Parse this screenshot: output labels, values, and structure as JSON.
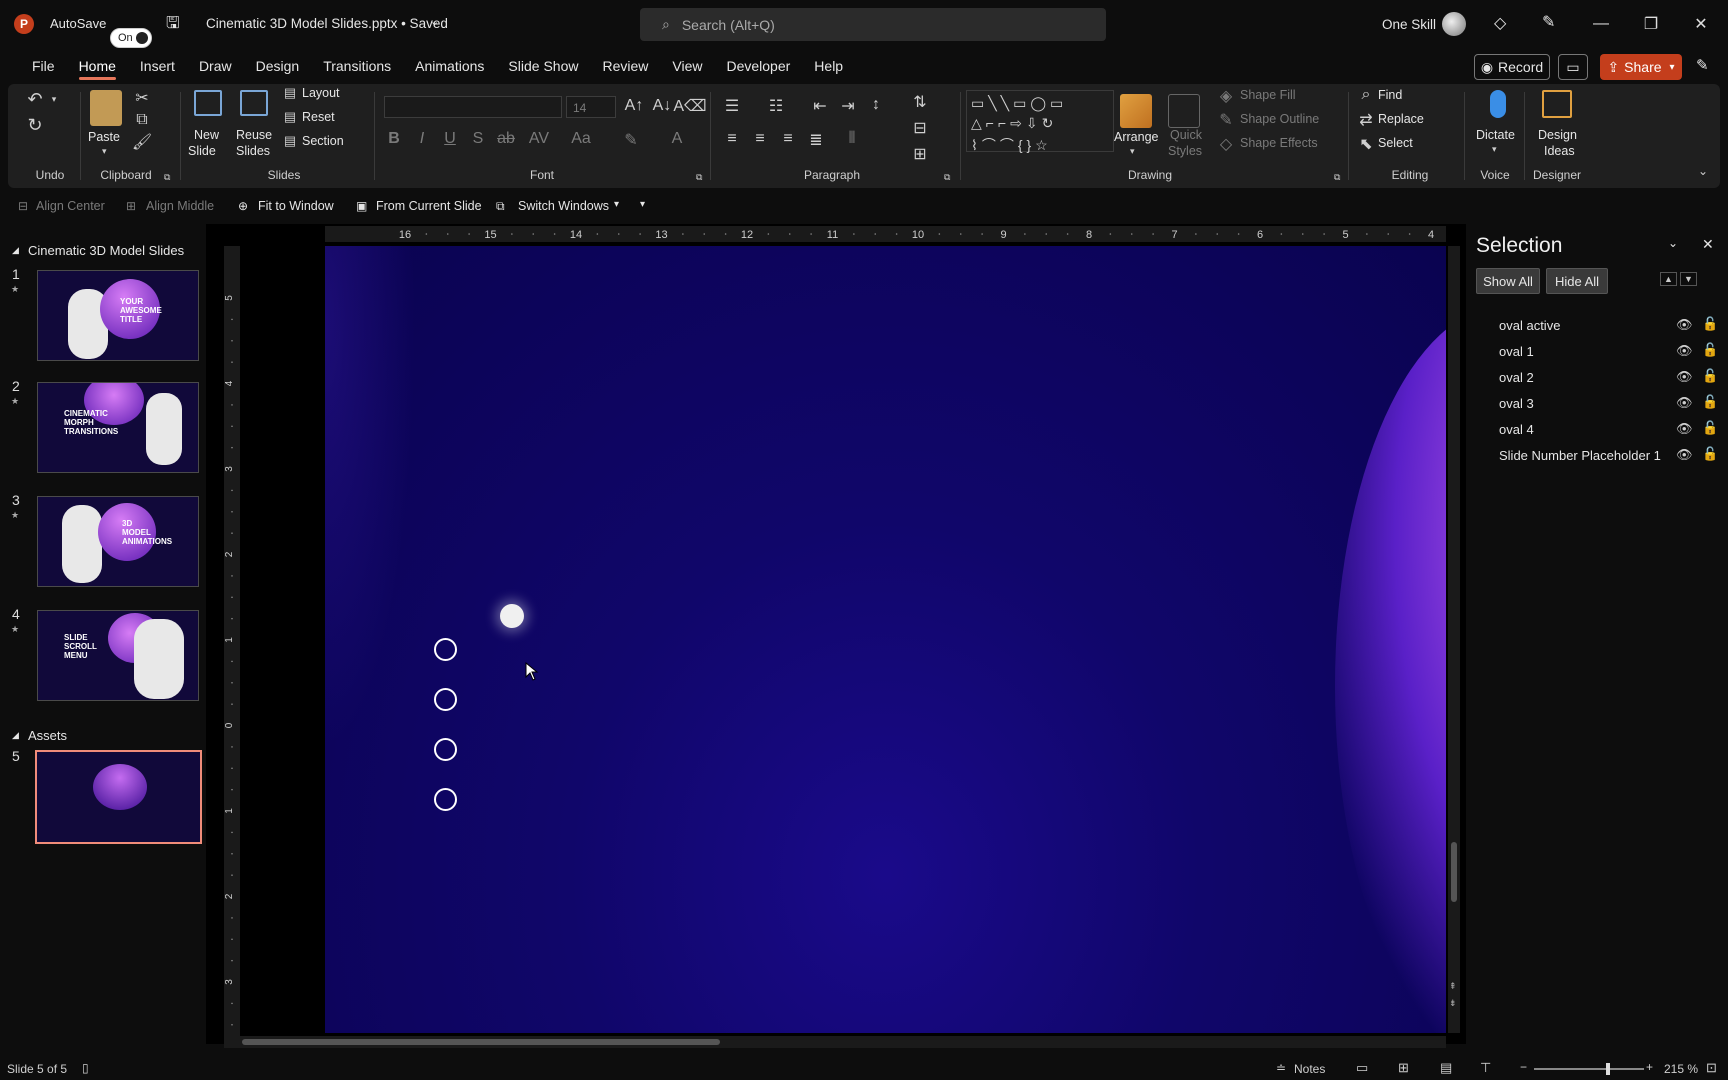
{
  "titlebar": {
    "app_logo": "P",
    "autosave_label": "AutoSave",
    "autosave_toggle": "On",
    "doc_title": "Cinematic 3D Model Slides.pptx • Saved",
    "search_placeholder": "Search (Alt+Q)",
    "user_name": "One Skill"
  },
  "menu": {
    "tabs": [
      "File",
      "Home",
      "Insert",
      "Draw",
      "Design",
      "Transitions",
      "Animations",
      "Slide Show",
      "Review",
      "View",
      "Developer",
      "Help"
    ],
    "record_label": "Record",
    "share_label": "Share"
  },
  "ribbon": {
    "groups": {
      "undo": "Undo",
      "clipboard": "Clipboard",
      "slides": "Slides",
      "font": "Font",
      "paragraph": "Paragraph",
      "drawing": "Drawing",
      "editing": "Editing",
      "voice": "Voice",
      "designer": "Designer"
    },
    "paste": "Paste",
    "new_slide_1": "New",
    "new_slide_2": "Slide",
    "reuse_1": "Reuse",
    "reuse_2": "Slides",
    "layout": "Layout",
    "reset": "Reset",
    "section": "Section",
    "font_size": "14",
    "arrange": "Arrange",
    "quick_styles_1": "Quick",
    "quick_styles_2": "Styles",
    "shape_fill": "Shape Fill",
    "shape_outline": "Shape Outline",
    "shape_effects": "Shape Effects",
    "find": "Find",
    "replace": "Replace",
    "select": "Select",
    "dictate": "Dictate",
    "design_ideas_1": "Design",
    "design_ideas_2": "Ideas"
  },
  "qat": {
    "align_center": "Align Center",
    "align_middle": "Align Middle",
    "fit_to_window": "Fit to Window",
    "from_current_slide": "From Current Slide",
    "switch_windows": "Switch Windows"
  },
  "thumbnails": {
    "section1": "Cinematic 3D Model Slides",
    "section2": "Assets",
    "slides": [
      {
        "num": "1",
        "title": "YOUR\nAWESOME\nTITLE"
      },
      {
        "num": "2",
        "title": "CINEMATIC\nMORPH\nTRANSITIONS"
      },
      {
        "num": "3",
        "title": "3D\nMODEL\nANIMATIONS"
      },
      {
        "num": "4",
        "title": "SLIDE\nSCROLL\nMENU"
      },
      {
        "num": "5",
        "title": ""
      }
    ]
  },
  "ruler": {
    "top": [
      "16",
      "15",
      "14",
      "13",
      "12",
      "11",
      "10",
      "9",
      "8",
      "7",
      "6",
      "5",
      "4"
    ],
    "left": [
      "5",
      "4",
      "3",
      "2",
      "1",
      "0",
      "1",
      "2",
      "3"
    ]
  },
  "selection_pane": {
    "title": "Selection",
    "show_all": "Show All",
    "hide_all": "Hide All",
    "items": [
      "oval active",
      "oval 1",
      "oval 2",
      "oval 3",
      "oval 4",
      "Slide Number Placeholder 1"
    ]
  },
  "status": {
    "slide_info": "Slide 5 of 5",
    "notes": "Notes",
    "zoom": "215 %"
  },
  "colors": {
    "accent": "#e6765a",
    "share": "#c43e1c",
    "slide_bg": "#10066a",
    "purple_glow": "#a94fe8"
  }
}
